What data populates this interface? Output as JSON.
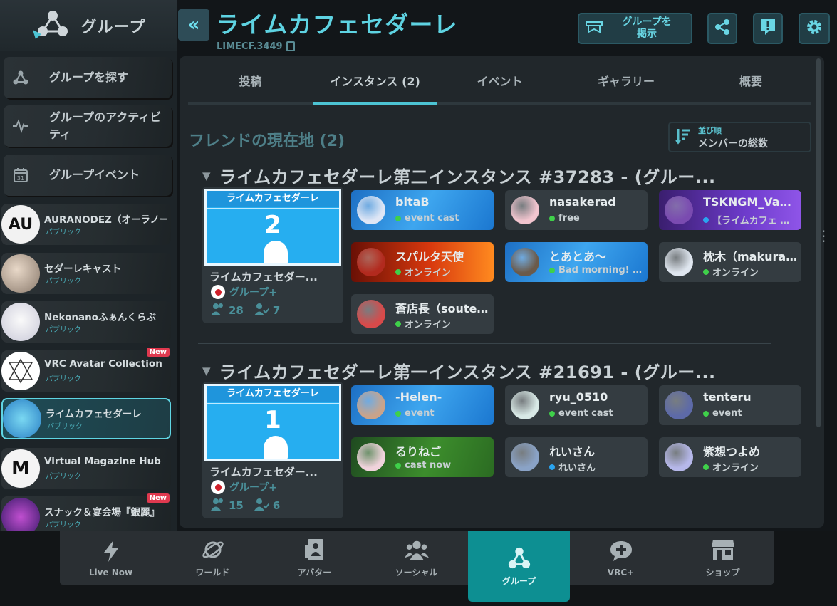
{
  "sidebar": {
    "title": "グループ",
    "nav": [
      {
        "label": "グループを探す",
        "icon": "group-node-icon"
      },
      {
        "label": "グループのアクティビティ",
        "icon": "activity-icon"
      },
      {
        "label": "グループイベント",
        "icon": "calendar-icon"
      }
    ],
    "calendar_day": "31",
    "groups": [
      {
        "name": "AURANODEZ（オーラノード）",
        "sub": "パブリック",
        "new": "",
        "initials": "AU"
      },
      {
        "name": "セダーレキャスト",
        "sub": "パブリック",
        "new": "",
        "initials": ""
      },
      {
        "name": "Nekonanoふぁんくらぶ",
        "sub": "パブリック",
        "new": "",
        "initials": ""
      },
      {
        "name": "VRC Avatar Collection",
        "sub": "パブリック",
        "new": "New",
        "initials": ""
      },
      {
        "name": "ライムカフェセダーレ",
        "sub": "パブリック",
        "new": "",
        "initials": ""
      },
      {
        "name": "Virtual Magazine Hub",
        "sub": "パブリック",
        "new": "",
        "initials": "M"
      },
      {
        "name": "スナック＆宴会場『銀麗』",
        "sub": "パブリック",
        "new": "New",
        "initials": ""
      }
    ]
  },
  "header": {
    "title": "ライムカフェセダーレ",
    "group_id": "LIMECF.3449",
    "post_button": "グループを\n掲示",
    "collapse": "«"
  },
  "tabs": [
    {
      "label": "投稿"
    },
    {
      "label": "インスタンス (2)"
    },
    {
      "label": "イベント"
    },
    {
      "label": "ギャラリー"
    },
    {
      "label": "概要"
    }
  ],
  "friends_title": "フレンドの現在地 (2)",
  "sort": {
    "key": "並び順",
    "value": "メンバーの総数"
  },
  "instances": [
    {
      "title": "ライムカフェセダーレ第二インスタンス #37283 - (グルー...",
      "thumb_header": "ライムカフェセダーレ",
      "thumb_number": "2",
      "card_name": "ライムカフェセダー...",
      "region": "グループ+",
      "count_total": "28",
      "count_friends": "7",
      "friends": [
        {
          "name": "bitaB",
          "status": "event cast",
          "dot": "#3fd04a",
          "bg": "water",
          "avatar": "#dfe6f5"
        },
        {
          "name": "nasakerad",
          "status": "free",
          "dot": "#3fd04a",
          "bg": "",
          "avatar": "#f2c5cf"
        },
        {
          "name": "TSKNGM_Vanilla",
          "status": "【ライムカフェ セダーレ】",
          "dot": "#2aa4f0",
          "bg": "purple",
          "avatar": "#7a4bb0"
        },
        {
          "name": "スパルタ天使",
          "status": "オンライン",
          "dot": "#3fd04a",
          "bg": "fire",
          "avatar": "#b22a1e"
        },
        {
          "name": "とあとあ～",
          "status": "Bad morning! Everyone!",
          "dot": "#3fd04a",
          "bg": "water",
          "avatar": "#6b5a4a"
        },
        {
          "name": "枕木（makuragi）",
          "status": "オンライン",
          "dot": "#3fd04a",
          "bg": "",
          "avatar": "#dfe6ef"
        },
        {
          "name": "蒼店長（soutencho）",
          "status": "オンライン",
          "dot": "#3fd04a",
          "bg": "",
          "avatar": "#d84a4a"
        }
      ]
    },
    {
      "title": "ライムカフェセダーレ第一インスタンス #21691 - (グルー...",
      "thumb_header": "ライムカフェセダーレ",
      "thumb_number": "1",
      "card_name": "ライムカフェセダー...",
      "region": "グループ+",
      "count_total": "15",
      "count_friends": "6",
      "friends": [
        {
          "name": "-Helen-",
          "status": "event",
          "dot": "#3fd04a",
          "bg": "water",
          "avatar": "#c9a38a"
        },
        {
          "name": "ryu_0510",
          "status": "event cast",
          "dot": "#3fd04a",
          "bg": "",
          "avatar": "#d8e9e6"
        },
        {
          "name": "tenteru",
          "status": "event",
          "dot": "#3fd04a",
          "bg": "",
          "avatar": "#5d6aa8"
        },
        {
          "name": "るりねご",
          "status": "cast now",
          "dot": "#3fd04a",
          "bg": "grass",
          "avatar": "#f0d3dc"
        },
        {
          "name": "れいさん",
          "status": "れいさん",
          "dot": "#2aa4f0",
          "bg": "",
          "avatar": "#8aa3c7"
        },
        {
          "name": "紫想つよめ",
          "status": "オンライン",
          "dot": "#3fd04a",
          "bg": "",
          "avatar": "#b6b8ea"
        }
      ]
    }
  ],
  "bottom_nav": [
    {
      "label": "Live Now",
      "icon": "lightning-icon"
    },
    {
      "label": "ワールド",
      "icon": "planet-icon"
    },
    {
      "label": "アバター",
      "icon": "avatar-icon"
    },
    {
      "label": "ソーシャル",
      "icon": "social-icon"
    },
    {
      "label": "グループ",
      "icon": "group-node-icon",
      "active": true
    },
    {
      "label": "VRC+",
      "icon": "vrc-plus-icon"
    },
    {
      "label": "ショップ",
      "icon": "shop-icon"
    }
  ],
  "colors": {
    "accent": "#5ed3e2",
    "active_nav": "#0d8f92",
    "online": "#3fd04a",
    "status_blue": "#2aa4f0",
    "new_badge": "#e0394f"
  }
}
